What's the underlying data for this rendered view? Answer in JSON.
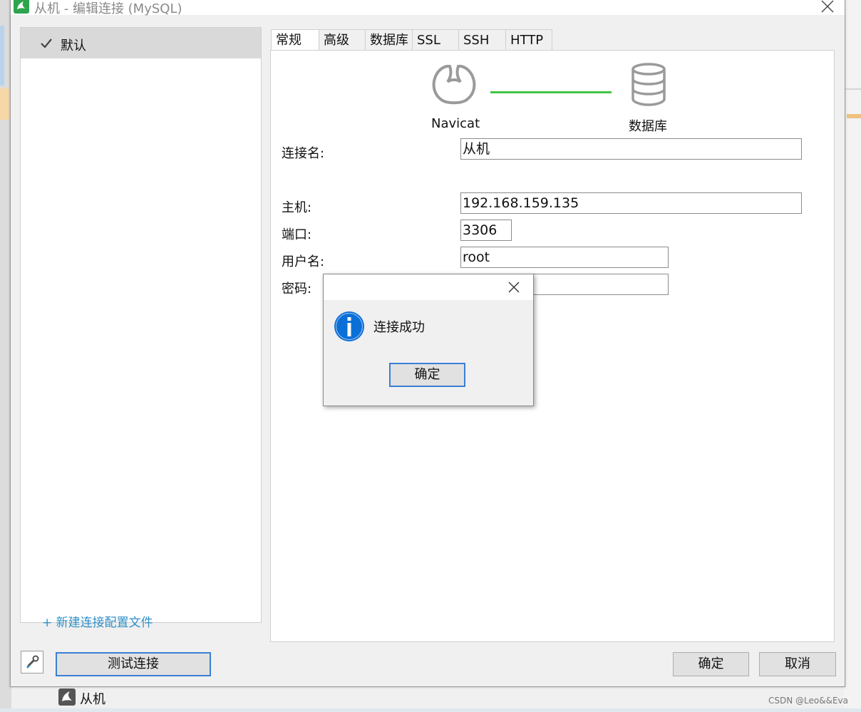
{
  "window": {
    "title": "从机 - 编辑连接 (MySQL)"
  },
  "sidebar": {
    "profiles": [
      {
        "label": "默认",
        "checked": true
      }
    ],
    "new_profile_link": "+ 新建连接配置文件"
  },
  "tabs": [
    {
      "label": "常规",
      "active": true
    },
    {
      "label": "高级",
      "active": false
    },
    {
      "label": "数据库",
      "active": false
    },
    {
      "label": "SSL",
      "active": false
    },
    {
      "label": "SSH",
      "active": false
    },
    {
      "label": "HTTP",
      "active": false
    }
  ],
  "graphic": {
    "left_label": "Navicat",
    "right_label": "数据库",
    "connector_color": "#44c544"
  },
  "form": {
    "connection_name_label": "连接名:",
    "connection_name_value": "从机",
    "host_label": "主机:",
    "host_value": "192.168.159.135",
    "port_label": "端口:",
    "port_value": "3306",
    "username_label": "用户名:",
    "username_value": "root",
    "password_label": "密码:",
    "password_value": ""
  },
  "dialog": {
    "message": "连接成功",
    "ok_label": "确定",
    "icon": "info-icon",
    "icon_color": "#0a6fd6"
  },
  "footer": {
    "test_button": "测试连接",
    "ok_button": "确定",
    "cancel_button": "取消"
  },
  "taskbar": {
    "item_label": "从机"
  },
  "watermark": "CSDN @Leo&&Eva"
}
